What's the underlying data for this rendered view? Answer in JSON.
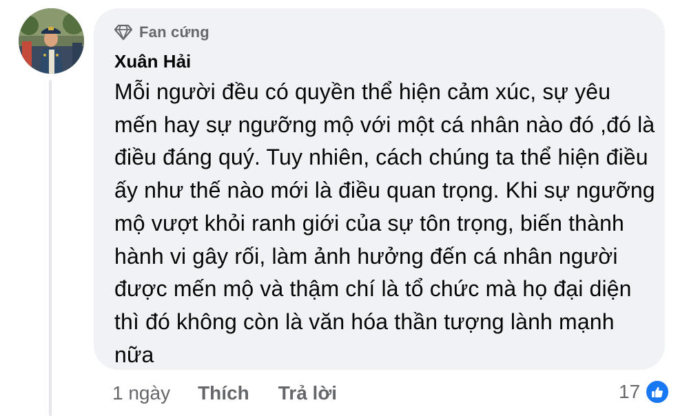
{
  "comment": {
    "badge_icon": "diamond-icon",
    "badge": "Fan cứng",
    "author": "Xuân Hải",
    "text": "Mỗi người đều có quyền thể hiện cảm xúc, sự yêu mến hay sự ngưỡng mộ với một cá nhân nào đó ,đó là điều đáng quý. Tuy nhiên, cách chúng ta thể hiện điều ấy như thế nào mới là điều quan trọng. Khi sự ngưỡng mộ vượt khỏi ranh giới của sự tôn trọng, biến thành hành vi gây rối, làm ảnh hưởng đến cá nhân người được mến mộ và thậm chí là tổ chức mà họ đại diện thì đó không còn là văn hóa thần tượng lành mạnh nữa",
    "time": "1 ngày",
    "like_label": "Thích",
    "reply_label": "Trả lời",
    "reaction_count": "17",
    "reaction_icon": "like-thumb-icon"
  },
  "colors": {
    "bubble_bg": "#f0f2f5",
    "secondary_text": "#65676b",
    "like_blue": "#1877f2"
  }
}
